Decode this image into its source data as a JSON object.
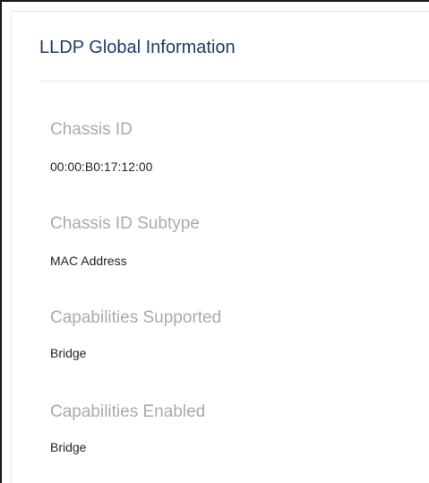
{
  "panel": {
    "title": "LLDP Global Information",
    "fields": [
      {
        "label": "Chassis ID",
        "value": "00:00:B0:17:12:00"
      },
      {
        "label": "Chassis ID Subtype",
        "value": "MAC Address"
      },
      {
        "label": "Capabilities Supported",
        "value": "Bridge"
      },
      {
        "label": "Capabilities Enabled",
        "value": "Bridge"
      }
    ]
  },
  "colors": {
    "title": "#1d3d73",
    "label": "#a7abb0",
    "value": "#262626",
    "border": "#e3e6ea"
  }
}
